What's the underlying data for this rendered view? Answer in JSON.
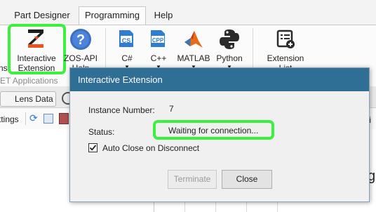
{
  "ribbon_tabs": [
    {
      "label": "Part Designer"
    },
    {
      "label": "Programming"
    },
    {
      "label": "Help"
    }
  ],
  "ribbon": {
    "left_cut_label": "ns",
    "interactive_extension": {
      "line1": "Interactive",
      "line2": "Extension"
    },
    "zos_api": {
      "line1": "ZOS-API",
      "line2": "Help"
    },
    "csharp": {
      "icon_text": "CS",
      "label": "C#"
    },
    "cpp": {
      "icon_text": "CPP",
      "label": "C++"
    },
    "matlab": {
      "label": "MATLAB"
    },
    "python": {
      "label": "Python"
    },
    "extension_list": {
      "line1": "Extension",
      "line2": "List"
    },
    "group_label": "ET Applications"
  },
  "doc_tabs": {
    "lens_data": "Lens Data"
  },
  "toolbar": {
    "settings_cut": "ttings"
  },
  "dialog": {
    "title": "Interactive Extension",
    "instance_label": "Instance Number:",
    "instance_value": "7",
    "status_label": "Status:",
    "status_value": "Waiting for connection...",
    "auto_close_label": "Auto Close on Disconnect",
    "auto_close_checked": true,
    "terminate_label": "Terminate",
    "close_label": "Close"
  },
  "colors": {
    "highlight": "#3df03d",
    "titlebar": "#2f6e95",
    "csharp_blue": "#2f7cd3"
  }
}
